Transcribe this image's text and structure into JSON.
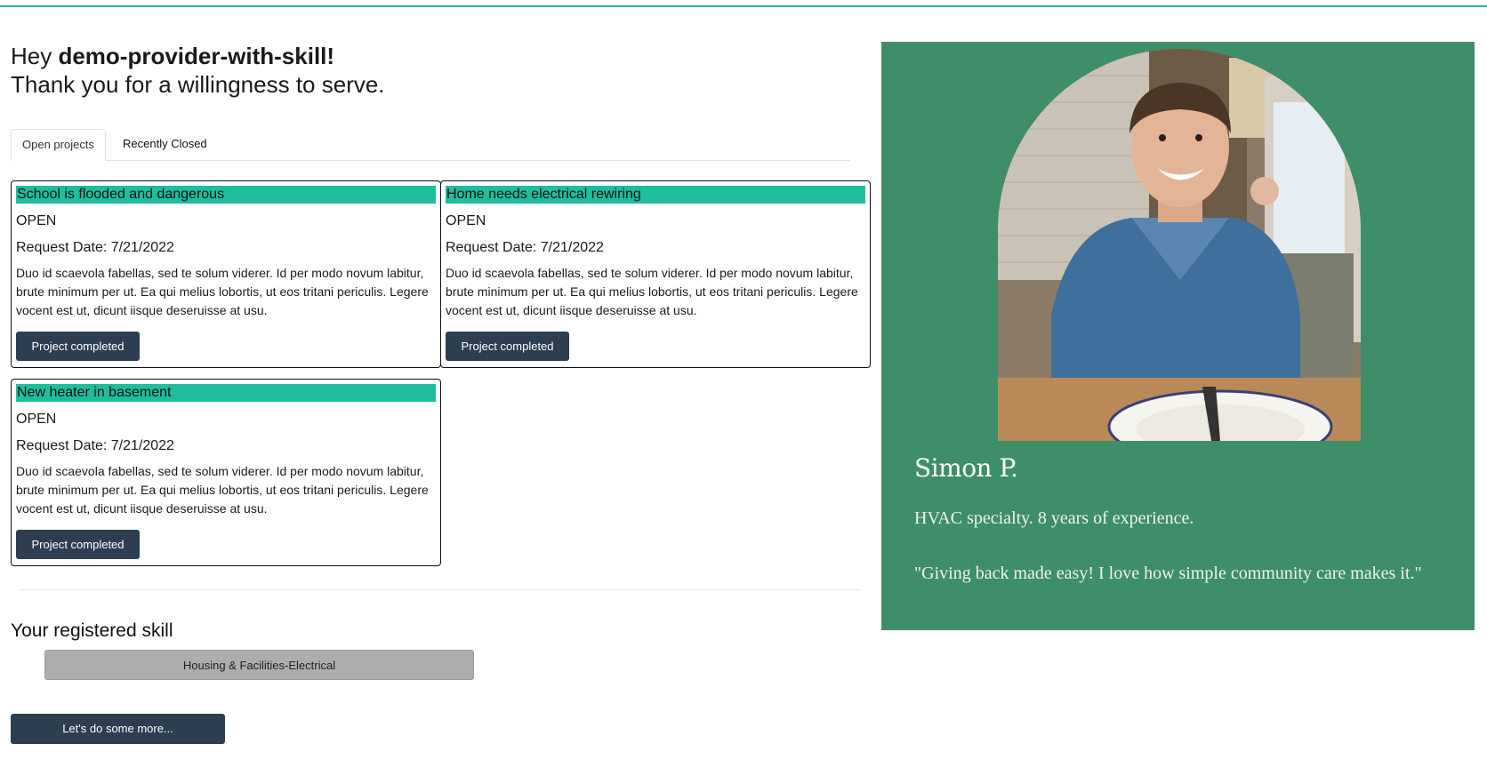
{
  "greeting": {
    "prefix": "Hey ",
    "username": "demo-provider-with-skill!",
    "line2": "Thank you for a willingness to serve."
  },
  "tabs": [
    {
      "label": "Open projects",
      "active": true
    },
    {
      "label": "Recently Closed",
      "active": false
    }
  ],
  "projects": [
    {
      "title": "School is flooded and dangerous",
      "status": "OPEN",
      "date": "Request Date: 7/21/2022",
      "description": "Duo id scaevola fabellas, sed te solum viderer. Id per modo novum labitur, brute minimum per ut. Ea qui melius lobortis, ut eos tritani periculis. Legere vocent est ut, dicunt iisque deseruisse at usu.",
      "button": "Project completed"
    },
    {
      "title": "Home needs electrical rewiring",
      "status": "OPEN",
      "date": "Request Date: 7/21/2022",
      "description": "Duo id scaevola fabellas, sed te solum viderer. Id per modo novum labitur, brute minimum per ut. Ea qui melius lobortis, ut eos tritani periculis. Legere vocent est ut, dicunt iisque deseruisse at usu.",
      "button": "Project completed"
    },
    {
      "title": "New heater in basement",
      "status": "OPEN",
      "date": "Request Date: 7/21/2022",
      "description": "Duo id scaevola fabellas, sed te solum viderer. Id per modo novum labitur, brute minimum per ut. Ea qui melius lobortis, ut eos tritani periculis. Legere vocent est ut, dicunt iisque deseruisse at usu.",
      "button": "Project completed"
    }
  ],
  "skills": {
    "heading": "Your registered skill",
    "items": [
      "Housing & Facilities-Electrical"
    ]
  },
  "more_button": "Let's do some more...",
  "profile": {
    "name": "Simon P.",
    "meta": "HVAC specialty. 8 years of experience.",
    "quote": "\"Giving back made easy! I love how simple community care makes it.\""
  },
  "colors": {
    "accent_rule": "#2bb5a8",
    "card_title_bg": "#1ebe9c",
    "button_bg": "#2c3e50",
    "panel_bg": "#3e8e6a",
    "skill_pill_bg": "#adadad"
  }
}
